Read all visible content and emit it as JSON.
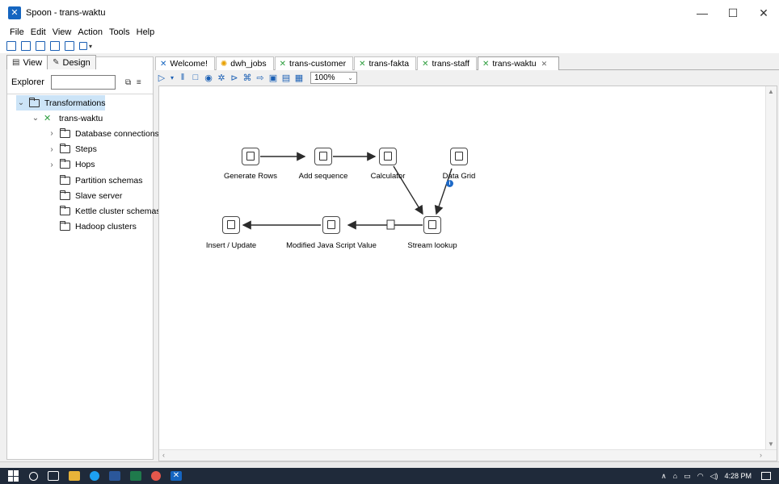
{
  "window": {
    "title": "Spoon - trans-waktu",
    "minimize_label": "—",
    "maximize_label": "☐",
    "close_label": "✕"
  },
  "menu": {
    "items": [
      {
        "label": "File"
      },
      {
        "label": "Edit"
      },
      {
        "label": "View"
      },
      {
        "label": "Action"
      },
      {
        "label": "Tools"
      },
      {
        "label": "Help"
      }
    ]
  },
  "left_panel": {
    "tabs": [
      {
        "label": "View",
        "icon": "document-icon"
      },
      {
        "label": "Design",
        "icon": "pencil-icon"
      }
    ],
    "explorer_label": "Explorer",
    "explorer_value": "",
    "tree": [
      {
        "label": "Transformations",
        "depth": 0,
        "caret": "⌄",
        "icon": "folder-icon",
        "selected": true
      },
      {
        "label": "trans-waktu",
        "depth": 1,
        "caret": "⌄",
        "icon": "transformation-icon",
        "selected": false
      },
      {
        "label": "Database connections",
        "depth": 2,
        "caret": "›",
        "icon": "folder-icon",
        "selected": false
      },
      {
        "label": "Steps",
        "depth": 2,
        "caret": "›",
        "icon": "folder-icon",
        "selected": false
      },
      {
        "label": "Hops",
        "depth": 2,
        "caret": "›",
        "icon": "folder-icon",
        "selected": false
      },
      {
        "label": "Partition schemas",
        "depth": 2,
        "caret": "",
        "icon": "folder-icon",
        "selected": false
      },
      {
        "label": "Slave server",
        "depth": 2,
        "caret": "",
        "icon": "folder-icon",
        "selected": false
      },
      {
        "label": "Kettle cluster schemas",
        "depth": 2,
        "caret": "",
        "icon": "folder-icon",
        "selected": false
      },
      {
        "label": "Hadoop clusters",
        "depth": 2,
        "caret": "",
        "icon": "folder-icon",
        "selected": false
      }
    ]
  },
  "editor_tabs": [
    {
      "label": "Welcome!",
      "icon": "spoon-icon",
      "color": "#1565c0",
      "active": false
    },
    {
      "label": "dwh_jobs",
      "icon": "job-icon",
      "color": "#e8a000",
      "active": false
    },
    {
      "label": "trans-customer",
      "icon": "transformation-icon",
      "color": "#2e9e3e",
      "active": false
    },
    {
      "label": "trans-fakta",
      "icon": "transformation-icon",
      "color": "#2e9e3e",
      "active": false
    },
    {
      "label": "trans-staff",
      "icon": "transformation-icon",
      "color": "#2e9e3e",
      "active": false
    },
    {
      "label": "trans-waktu",
      "icon": "transformation-icon",
      "color": "#2e9e3e",
      "active": true
    }
  ],
  "editor_toolbar": {
    "zoom": "100%"
  },
  "steps": [
    {
      "id": "generate-rows",
      "label": "Generate Rows"
    },
    {
      "id": "add-sequence",
      "label": "Add sequence"
    },
    {
      "id": "calculator",
      "label": "Calculator"
    },
    {
      "id": "data-grid",
      "label": "Data Grid"
    },
    {
      "id": "stream-lookup",
      "label": "Stream lookup"
    },
    {
      "id": "modified-java-script-value",
      "label": "Modified Java Script Value"
    },
    {
      "id": "insert-update",
      "label": "Insert / Update"
    }
  ],
  "taskbar": {
    "time": "4:28 PM"
  },
  "colors": {
    "accent_blue": "#1a5fb4",
    "transformation_green": "#2e9e3e",
    "taskbar": "#1f2a3a",
    "selection": "#cce4f7"
  }
}
